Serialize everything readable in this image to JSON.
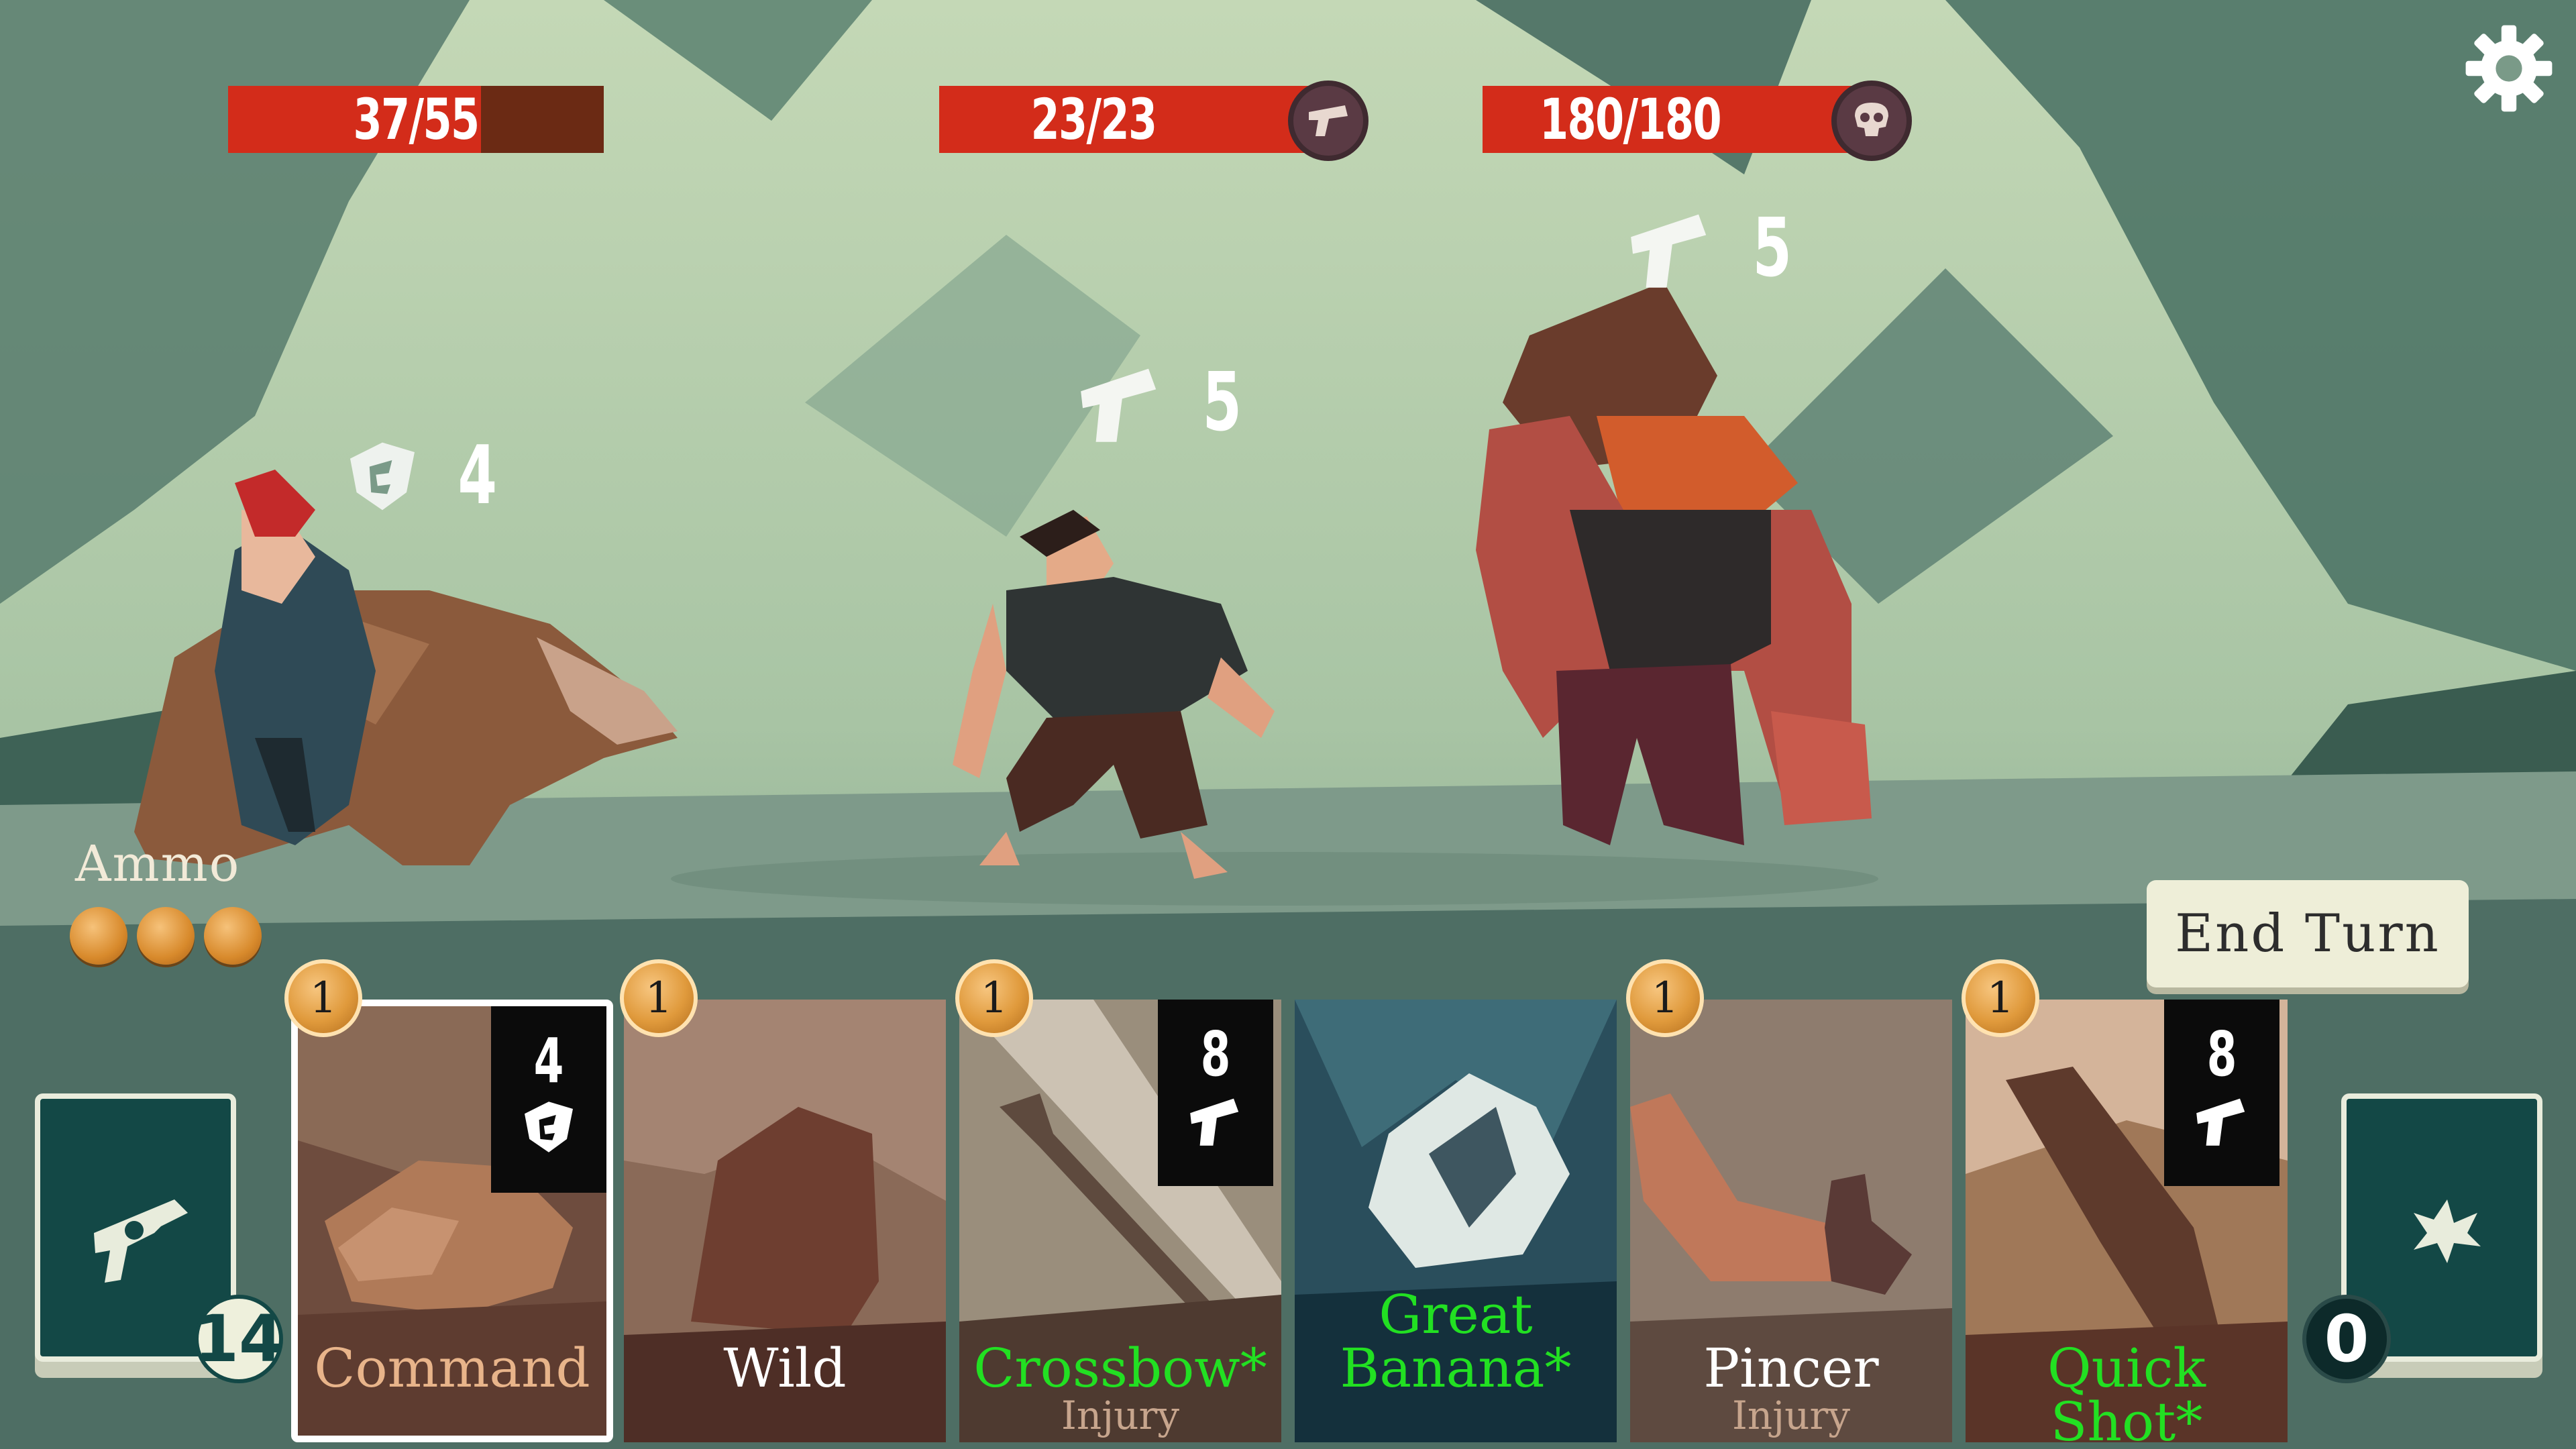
{
  "hud": {
    "player_hp": "37/55",
    "player_hp_fraction": 0.674,
    "enemy1_hp": "23/23",
    "enemy1_hp_fraction": 1.0,
    "enemy2_hp": "180/180",
    "enemy2_hp_fraction": 1.0,
    "enemy1_badge_icon": "pistol-icon",
    "enemy2_badge_icon": "skull-icon",
    "settings_icon": "gear-icon"
  },
  "player": {
    "block_icon": "shield-icon",
    "block_value": "4"
  },
  "enemies": [
    {
      "intent_icon": "pistol-icon",
      "intent_value": "5"
    },
    {
      "intent_icon": "pistol-icon",
      "intent_value": "5"
    }
  ],
  "ammo": {
    "label": "Ammo",
    "count": 3
  },
  "end_turn_label": "End Turn",
  "draw_pile": {
    "icon": "revolver-icon",
    "count": "14"
  },
  "discard_pile": {
    "icon": "splat-icon",
    "count": "0"
  },
  "hand": [
    {
      "name": "Command",
      "sub": "",
      "cost": "1",
      "value": "4",
      "value_icon": "shield-icon",
      "name_color": "#e8b48a",
      "selected": true
    },
    {
      "name": "Wild",
      "sub": "",
      "cost": "1",
      "value": "",
      "value_icon": "",
      "name_color": "#ffffff",
      "selected": false
    },
    {
      "name": "Crossbow*",
      "sub": "Injury",
      "cost": "1",
      "value": "8",
      "value_icon": "pistol-icon",
      "name_color": "#22e022",
      "selected": false
    },
    {
      "name": "Great",
      "name2": "Banana*",
      "sub": "",
      "cost": "",
      "value": "",
      "value_icon": "",
      "name_color": "#22e022",
      "selected": false
    },
    {
      "name": "Pincer",
      "sub": "Injury",
      "cost": "1",
      "value": "",
      "value_icon": "",
      "name_color": "#ffffff",
      "selected": false
    },
    {
      "name": "Quick Shot*",
      "sub": "",
      "cost": "1",
      "value": "8",
      "value_icon": "pistol-icon",
      "name_color": "#22e022",
      "selected": false
    }
  ],
  "colors": {
    "hp_fill": "#d32c1a",
    "hp_empty": "#6b2a14",
    "card_name_green": "#22e022",
    "pile_bg": "#134846"
  }
}
